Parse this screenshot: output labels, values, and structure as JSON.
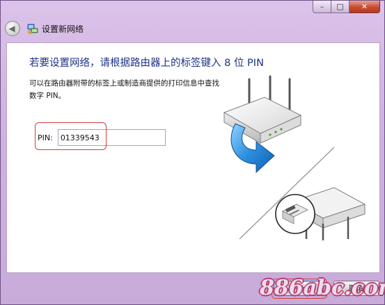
{
  "window": {
    "title": "设置新网络",
    "caption_buttons": {
      "minimize": "–",
      "maximize": "□",
      "close": "✕"
    }
  },
  "icons": {
    "back": "back-arrow-icon",
    "network": "network-setup-icon"
  },
  "main": {
    "heading": "若要设置网络，请根据路由器上的标签键入 8 位 PIN",
    "description": "可以在路由器附带的标签上或制造商提供的打印信息中查找数字 PIN。",
    "pin_label": "PIN:",
    "pin_value": "01339543"
  },
  "footer": {
    "next_label": "下一步(N)",
    "cancel_label": "取消"
  },
  "watermark": "886abc.com",
  "colors": {
    "heading": "#1e3287",
    "highlight": "#d63a3a",
    "frame": "#cfb2e0"
  }
}
